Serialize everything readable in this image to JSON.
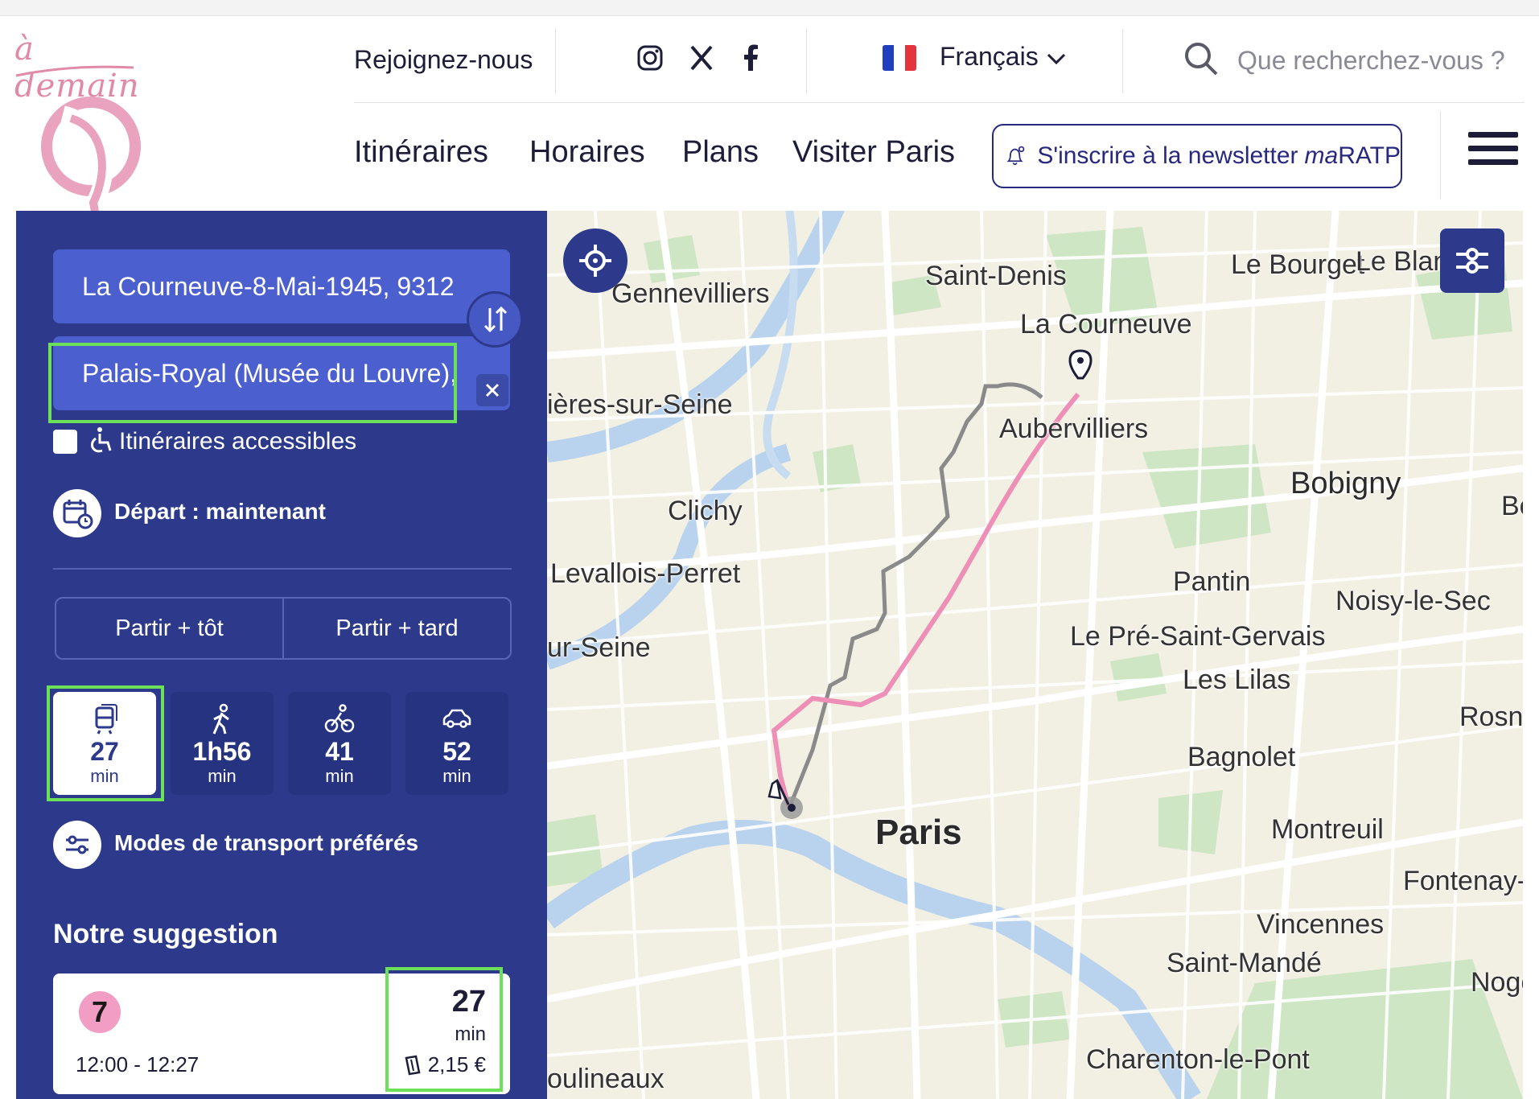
{
  "header": {
    "logo_text": "à demain",
    "join_label": "Rejoignez-nous",
    "social": [
      "instagram-icon",
      "x-icon",
      "facebook-icon"
    ],
    "language": "Français",
    "search_placeholder": "Que recherchez-vous ?",
    "nav": [
      "Itinéraires",
      "Horaires",
      "Plans",
      "Visiter Paris"
    ],
    "newsletter_label": "S'inscrire à la newsletter",
    "newsletter_brand_ma": "ma",
    "newsletter_brand_ratp": "RATP"
  },
  "planner": {
    "from": "La Courneuve-8-Mai-1945, 9312",
    "to": "Palais-Royal (Musée du Louvre),",
    "accessible_label": "Itinéraires accessibles",
    "depart_label": "Départ : maintenant",
    "earlier_label": "Partir + tôt",
    "later_label": "Partir + tard",
    "modes": [
      {
        "icon": "transit-icon",
        "value": "27",
        "unit": "min",
        "active": true
      },
      {
        "icon": "walk-icon",
        "value": "1h56",
        "unit": "min",
        "active": false
      },
      {
        "icon": "bike-icon",
        "value": "41",
        "unit": "min",
        "active": false
      },
      {
        "icon": "car-icon",
        "value": "52",
        "unit": "min",
        "active": false
      }
    ],
    "preferred_modes_label": "Modes de transport préférés",
    "suggestion_title": "Notre suggestion",
    "suggestion": {
      "line": "7",
      "line_color": "#f29dc3",
      "time_range": "12:00 - 12:27",
      "duration": "27",
      "duration_unit": "min",
      "price": "2,15 €"
    }
  },
  "map": {
    "labels": [
      "Gennevilliers",
      "Saint-Denis",
      "Le Bourget",
      "Le Blanc-",
      "La Courneuve",
      "ières-sur-Seine",
      "Aubervilliers",
      "Bobigny",
      "Bo",
      "Clichy",
      "Levallois-Perret",
      "Pantin",
      "Noisy-le-Sec",
      "Le Pré-Saint-Gervais",
      "ur-Seine",
      "Les Lilas",
      "Rosny-",
      "Bagnolet",
      "Paris",
      "Montreuil",
      "Fontenay-so",
      "Vincennes",
      "Saint-Mandé",
      "Noge",
      "Charenton-le-Pont",
      "oulineaux"
    ],
    "route_color": "#ee8fb7"
  },
  "colors": {
    "brand_blue": "#2d3a8c",
    "field_blue": "#4b5fcf",
    "highlight_green": "#6de05a",
    "logo_pink": "#e08aa8"
  }
}
